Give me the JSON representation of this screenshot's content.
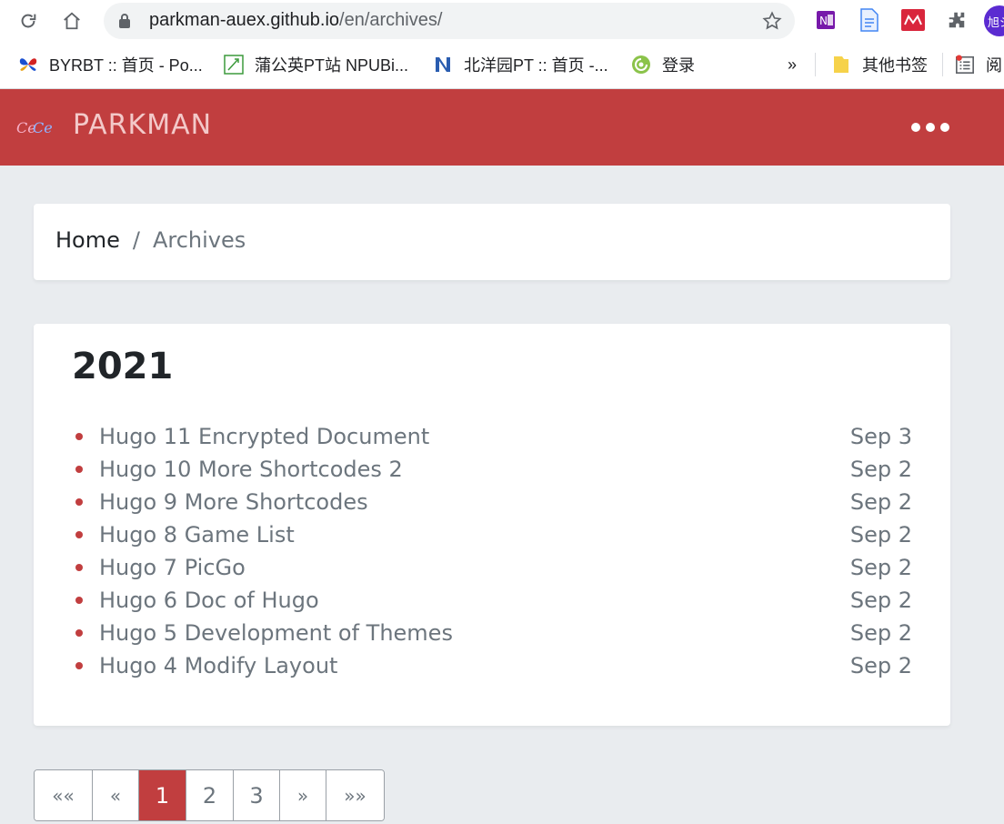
{
  "browser": {
    "url_host": "parkman-auex.github.io",
    "url_path": "/en/archives/",
    "profile_initial": "旭ジ",
    "bookmarks": [
      {
        "label": "BYRBT :: 首页 - Po...",
        "icon": "butterfly-icon"
      },
      {
        "label": "蒲公英PT站 NPUBi...",
        "icon": "dandelion-icon"
      },
      {
        "label": "北洋园PT :: 首页 -...",
        "icon": "tju-icon"
      },
      {
        "label": "登录",
        "icon": "swirl-icon"
      }
    ],
    "bookmarks_overflow": "»",
    "other_bookmarks": "其他书签",
    "reading_list": "阅"
  },
  "site": {
    "brand": "PARKMAN"
  },
  "breadcrumb": {
    "home": "Home",
    "separator": "/",
    "current": "Archives"
  },
  "archive": {
    "year": "2021",
    "posts": [
      {
        "title": "Hugo 11 Encrypted Document",
        "date": "Sep 3"
      },
      {
        "title": "Hugo 10 More Shortcodes 2",
        "date": "Sep 2"
      },
      {
        "title": "Hugo 9 More Shortcodes",
        "date": "Sep 2"
      },
      {
        "title": "Hugo 8 Game List",
        "date": "Sep 2"
      },
      {
        "title": "Hugo 7 PicGo",
        "date": "Sep 2"
      },
      {
        "title": "Hugo 6 Doc of Hugo",
        "date": "Sep 2"
      },
      {
        "title": "Hugo 5 Development of Themes",
        "date": "Sep 2"
      },
      {
        "title": "Hugo 4 Modify Layout",
        "date": "Sep 2"
      }
    ]
  },
  "pagination": {
    "first": "««",
    "prev": "«",
    "pages": [
      "1",
      "2",
      "3"
    ],
    "current": "1",
    "next": "»",
    "last": "»»"
  },
  "colors": {
    "brand_red": "#c13e3f",
    "page_bg": "#e9ecef"
  }
}
